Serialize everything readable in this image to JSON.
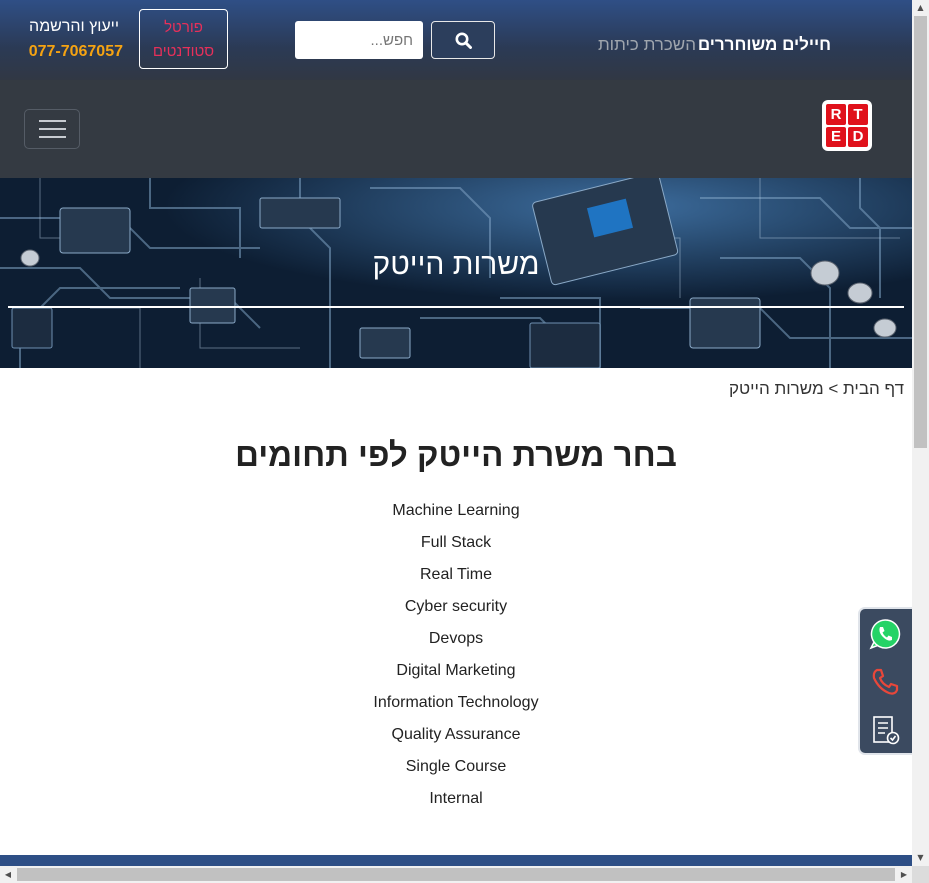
{
  "topbar": {
    "contact_label": "ייעוץ והרשמה",
    "contact_phone": "077-7067057",
    "portal_button": "פורטל סטודנטים",
    "search": {
      "placeholder": "חפש...",
      "button_icon": "search-icon"
    },
    "nav": [
      {
        "label": "חיילים משוחררים"
      },
      {
        "label": "השכרת כיתות"
      }
    ]
  },
  "navbar": {
    "toggler_icon": "hamburger-menu-icon",
    "logo_letters": [
      "R",
      "T",
      "E",
      "D"
    ]
  },
  "hero": {
    "title": "משרות הייטק"
  },
  "breadcrumb": "דף הבית > משרות הייטק",
  "main": {
    "title": "בחר משרת הייטק לפי תחומים",
    "categories": [
      "Machine Learning",
      "Full Stack",
      "Real Time",
      "Cyber security",
      "Devops",
      "Digital Marketing",
      "Information Technology",
      "Quality Assurance",
      "Single Course",
      "Internal"
    ]
  },
  "float_panel": {
    "icons": [
      "whatsapp-icon",
      "phone-icon",
      "form-icon"
    ]
  },
  "colors": {
    "accent_orange": "#f5a312",
    "portal_red": "#e6305a",
    "logo_red": "#e0111b",
    "navbar_dark": "#343a42",
    "whatsapp_green": "#25d366"
  }
}
